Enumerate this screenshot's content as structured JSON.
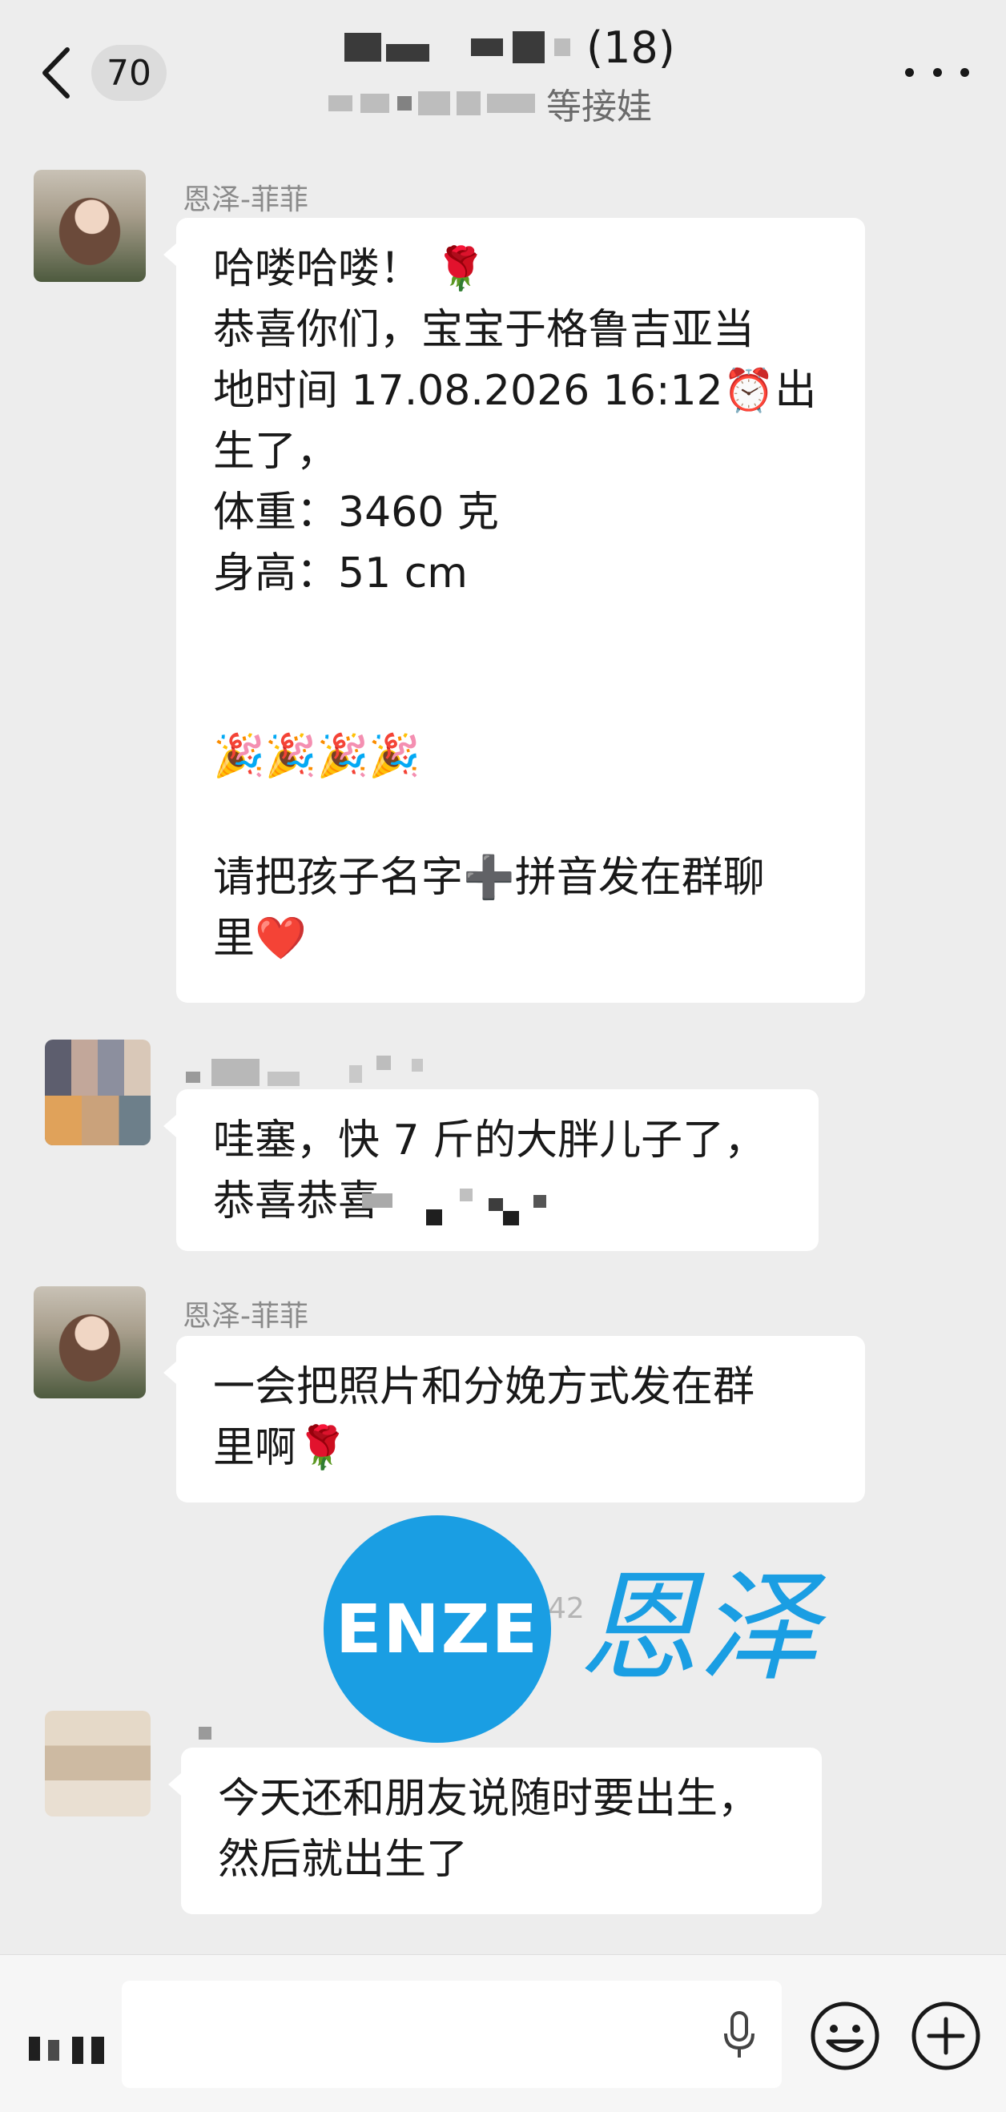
{
  "header": {
    "unread_count": "70",
    "member_count": "(18)",
    "subtitle_suffix": "等接娃"
  },
  "messages": [
    {
      "sender": "恩泽-菲菲",
      "lines": [
        "哈喽哈喽！ 🌹",
        "恭喜你们，宝宝于格鲁吉亚当",
        "地时间 17.08.2026 16:12⏰出",
        "生了，",
        "体重：3460 克",
        "身高：51 cm",
        "",
        "",
        "🎉🎉🎉🎉",
        "",
        "请把孩子名字➕拼音发在群聊",
        "里❤️"
      ]
    },
    {
      "sender": "",
      "lines": [
        "哇塞，快 7 斤的大胖儿子了，",
        "恭喜恭喜"
      ]
    },
    {
      "sender": "恩泽-菲菲",
      "lines": [
        "一会把照片和分娩方式发在群",
        "里啊🌹"
      ]
    },
    {
      "sender": "",
      "lines": [
        "今天还和朋友说随时要出生，",
        "然后就出生了"
      ]
    }
  ],
  "watermark": {
    "logo_text": "ENZE",
    "logo_cn": "恩泽",
    "time_fragment": "42"
  },
  "icons": {
    "back": "chevron-left-icon",
    "more": "more-dots-icon",
    "mic": "mic-icon",
    "emoji": "emoji-icon",
    "plus": "plus-icon"
  },
  "colors": {
    "background": "#ededed",
    "bubble": "#ffffff",
    "watermark": "#1a9ee3"
  }
}
